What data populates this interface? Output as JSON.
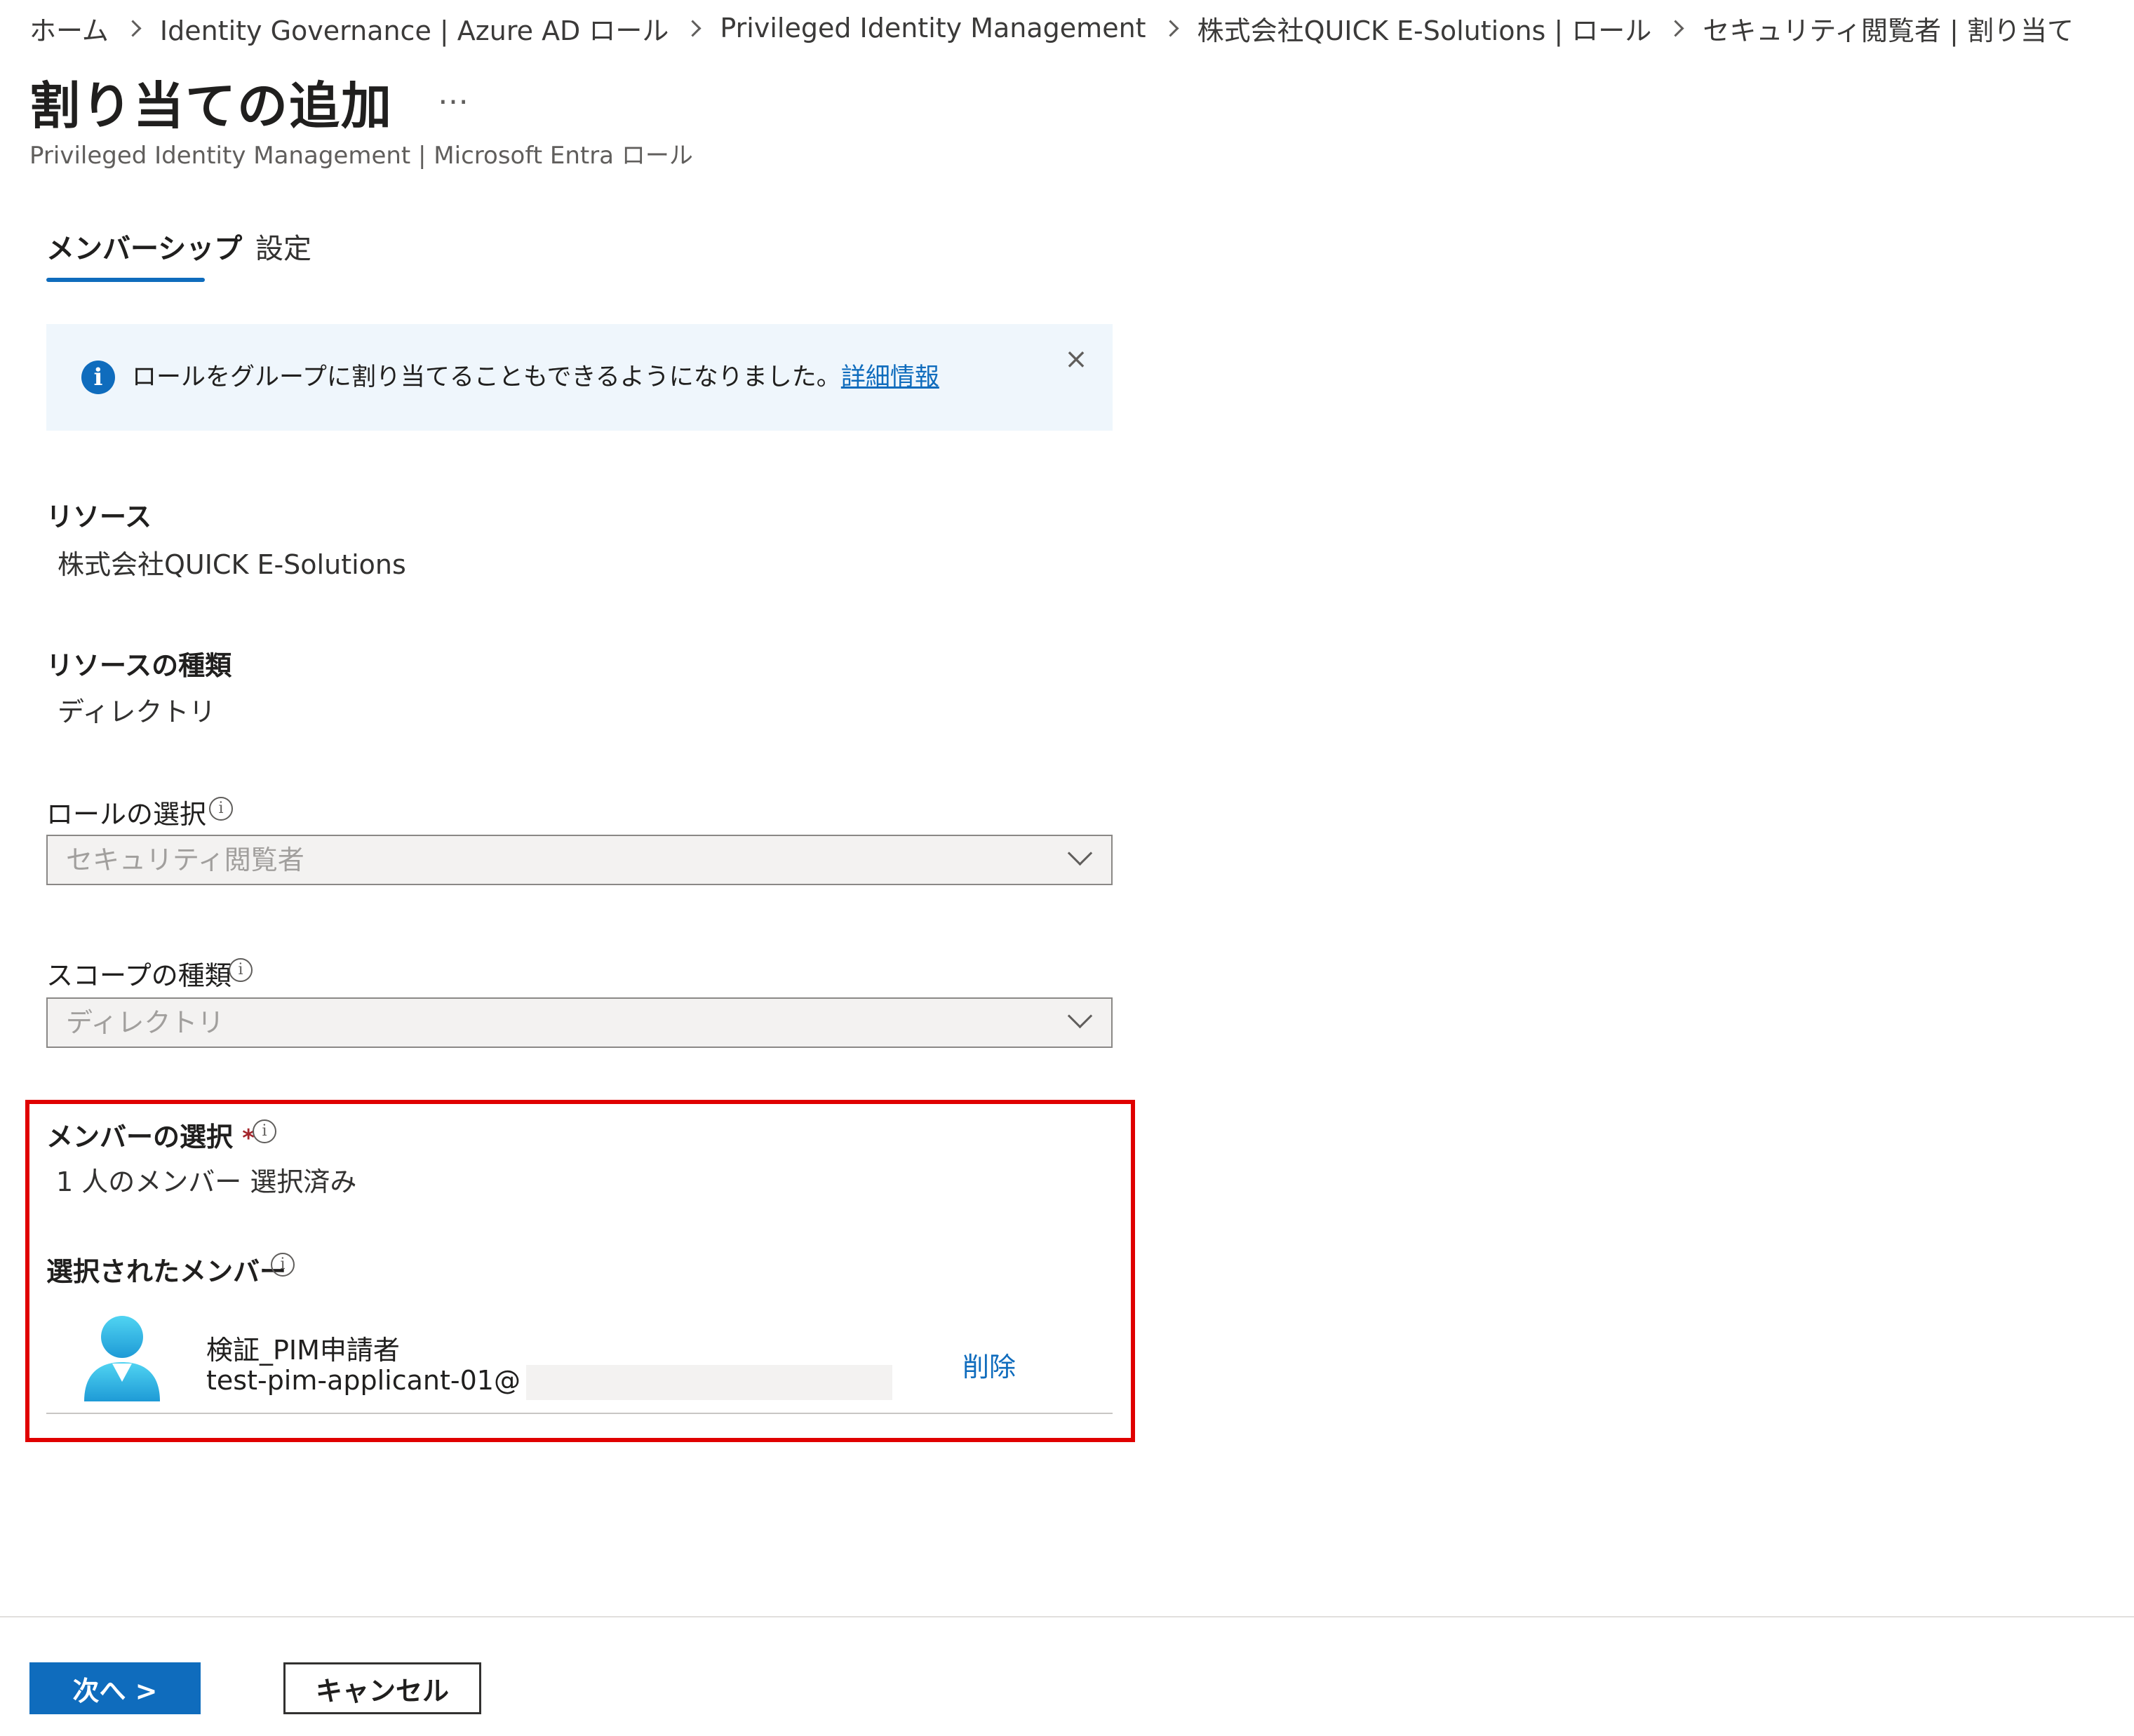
{
  "breadcrumb": [
    "ホーム",
    "Identity Governance | Azure AD ロール",
    "Privileged Identity Management",
    "株式会社QUICK E-Solutions | ロール",
    "セキュリティ閲覧者 | 割り当て"
  ],
  "header": {
    "title": "割り当ての追加",
    "more": "…",
    "subtitle": "Privileged Identity Management | Microsoft Entra ロール"
  },
  "tabs": [
    {
      "label": "メンバーシップ",
      "active": true
    },
    {
      "label": "設定",
      "active": false
    }
  ],
  "banner": {
    "text": "ロールをグループに割り当てることもできるようになりました。",
    "link": "詳細情報",
    "close": "×"
  },
  "resource": {
    "label": "リソース",
    "value": "株式会社QUICK E-Solutions"
  },
  "resource_type": {
    "label": "リソースの種類",
    "value": "ディレクトリ"
  },
  "role_select": {
    "label": "ロールの選択",
    "value": "セキュリティ閲覧者"
  },
  "scope_type": {
    "label": "スコープの種類",
    "value": "ディレクトリ"
  },
  "member_select": {
    "label": "メンバーの選択",
    "required_mark": "*",
    "link": "1 人のメンバー 選択済み"
  },
  "selected_members": {
    "label": "選択されたメンバー",
    "items": [
      {
        "name": "検証_PIM申請者",
        "email": "test-pim-applicant-01@",
        "action": "削除"
      }
    ]
  },
  "footer": {
    "next": "次へ >",
    "cancel": "キャンセル"
  },
  "colors": {
    "accent": "#0f6cbd",
    "highlight": "#e00000",
    "banner_bg": "#eff6fc"
  },
  "icons": {
    "info": "info-icon",
    "close": "close-icon",
    "chevron": "chevron-down-icon",
    "avatar": "user-avatar-icon"
  }
}
